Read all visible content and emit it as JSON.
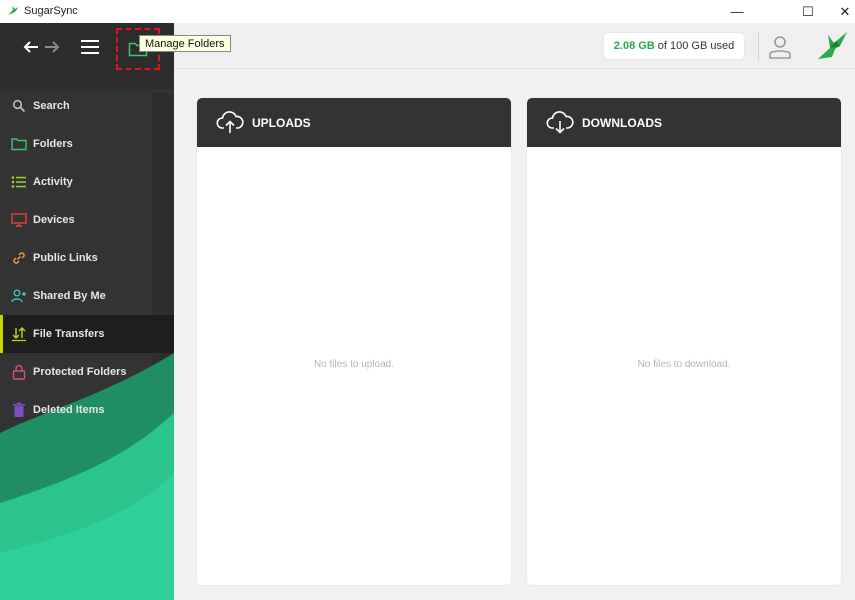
{
  "window": {
    "title": "SugarSync",
    "minimize_glyph": "—",
    "maximize_glyph": "☐",
    "close_glyph": "✕"
  },
  "toolbar": {
    "tooltip": "Manage Folders",
    "icons": [
      "back-arrow-icon",
      "forward-arrow-icon",
      "hamburger-menu-icon",
      "folder-icon"
    ]
  },
  "sidebar": {
    "items": [
      {
        "label": "Search",
        "icon": "search-icon",
        "color": "#bdbdbd"
      },
      {
        "label": "Folders",
        "icon": "folder-icon",
        "color": "#3ec46d"
      },
      {
        "label": "Activity",
        "icon": "activity-list-icon",
        "color": "#9ccc3c"
      },
      {
        "label": "Devices",
        "icon": "monitor-icon",
        "color": "#e0413a"
      },
      {
        "label": "Public Links",
        "icon": "link-icon",
        "color": "#e89a3c"
      },
      {
        "label": "Shared By Me",
        "icon": "share-user-icon",
        "color": "#3cc2b8"
      },
      {
        "label": "File Transfers",
        "icon": "transfer-arrows-icon",
        "color": "#c8d400"
      },
      {
        "label": "Protected Folders",
        "icon": "lock-icon",
        "color": "#e04a8a"
      },
      {
        "label": "Deleted Items",
        "icon": "trash-icon",
        "color": "#7a4fc4"
      }
    ],
    "active_index": 6
  },
  "header": {
    "storage_used": "2.08 GB",
    "storage_rest": "of 100 GB used",
    "accent": "#2aa84a"
  },
  "panels": {
    "uploads": {
      "title": "UPLOADS",
      "empty": "No files to upload."
    },
    "downloads": {
      "title": "DOWNLOADS",
      "empty": "No files to download."
    }
  }
}
